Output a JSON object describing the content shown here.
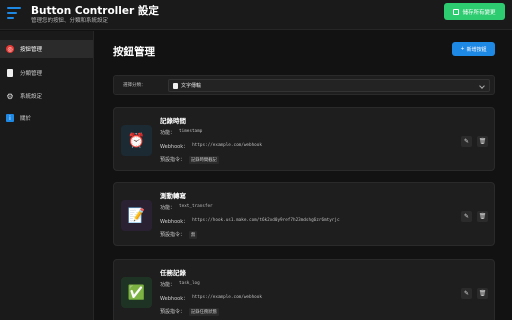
{
  "header": {
    "title": "Button Controller 設定",
    "subtitle": "管理您的按鈕、分類和系統設定",
    "save_all_label": "儲存所有變更"
  },
  "sidebar": {
    "items": [
      {
        "label": "按鈕管理",
        "icon": "target-icon",
        "active": true
      },
      {
        "label": "分類管理",
        "icon": "document-icon",
        "active": false
      },
      {
        "label": "系統設定",
        "icon": "gear-icon",
        "active": false
      },
      {
        "label": "關於",
        "icon": "info-icon",
        "active": false
      }
    ]
  },
  "main": {
    "page_title": "按鈕管理",
    "add_button_label": "新增按鈕",
    "filter": {
      "label": "選擇分類：",
      "selected": "文字傳輸"
    },
    "cards": [
      {
        "title": "記錄時間",
        "icon": "alarm-clock-icon",
        "function_label": "功能：",
        "function_value": "timestamp",
        "webhook_label": "Webhook：",
        "webhook_value": "https://example.com/webhook",
        "command_label": "預設指令：",
        "command_value": "記錄時間截記"
      },
      {
        "title": "測動轉寫",
        "icon": "memo-icon",
        "function_label": "功能：",
        "function_value": "text_transfer",
        "webhook_label": "Webhook：",
        "webhook_value": "https://hook.us1.make.com/t6k2xd0y9ref7h23mdshg6zr6mtyrjc",
        "command_label": "預設指令：",
        "command_value": "無"
      },
      {
        "title": "任務記錄",
        "icon": "check-mark-icon",
        "function_label": "功能：",
        "function_value": "task_log",
        "webhook_label": "Webhook：",
        "webhook_value": "https://example.com/webhook",
        "command_label": "預設指令：",
        "command_value": "記錄任務狀態"
      }
    ]
  },
  "colors": {
    "accent": "#1e88e5",
    "save": "#2ecc71",
    "background": "#121212",
    "panel": "#1e1e1e"
  }
}
